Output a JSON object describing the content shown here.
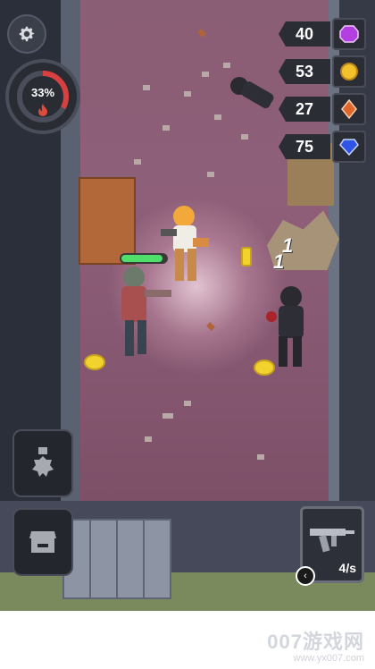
{
  "hud": {
    "heat_percent": "33%",
    "resources": [
      {
        "value": "40",
        "icon": "purple-gem-icon",
        "color": "#b43fe0"
      },
      {
        "value": "53",
        "icon": "gold-coin-icon",
        "color": "#f2c12e"
      },
      {
        "value": "27",
        "icon": "orange-crystal-icon",
        "color": "#e0672c"
      },
      {
        "value": "75",
        "icon": "blue-gem-icon",
        "color": "#2f54e8"
      }
    ]
  },
  "combat": {
    "damage_numbers": [
      "1",
      "1"
    ],
    "player_health_fraction": 0.92
  },
  "weapon": {
    "fire_rate": "4/s",
    "prev_symbol": "‹"
  },
  "watermark": {
    "main": "007游戏网",
    "sub": "www.yx007.com"
  }
}
